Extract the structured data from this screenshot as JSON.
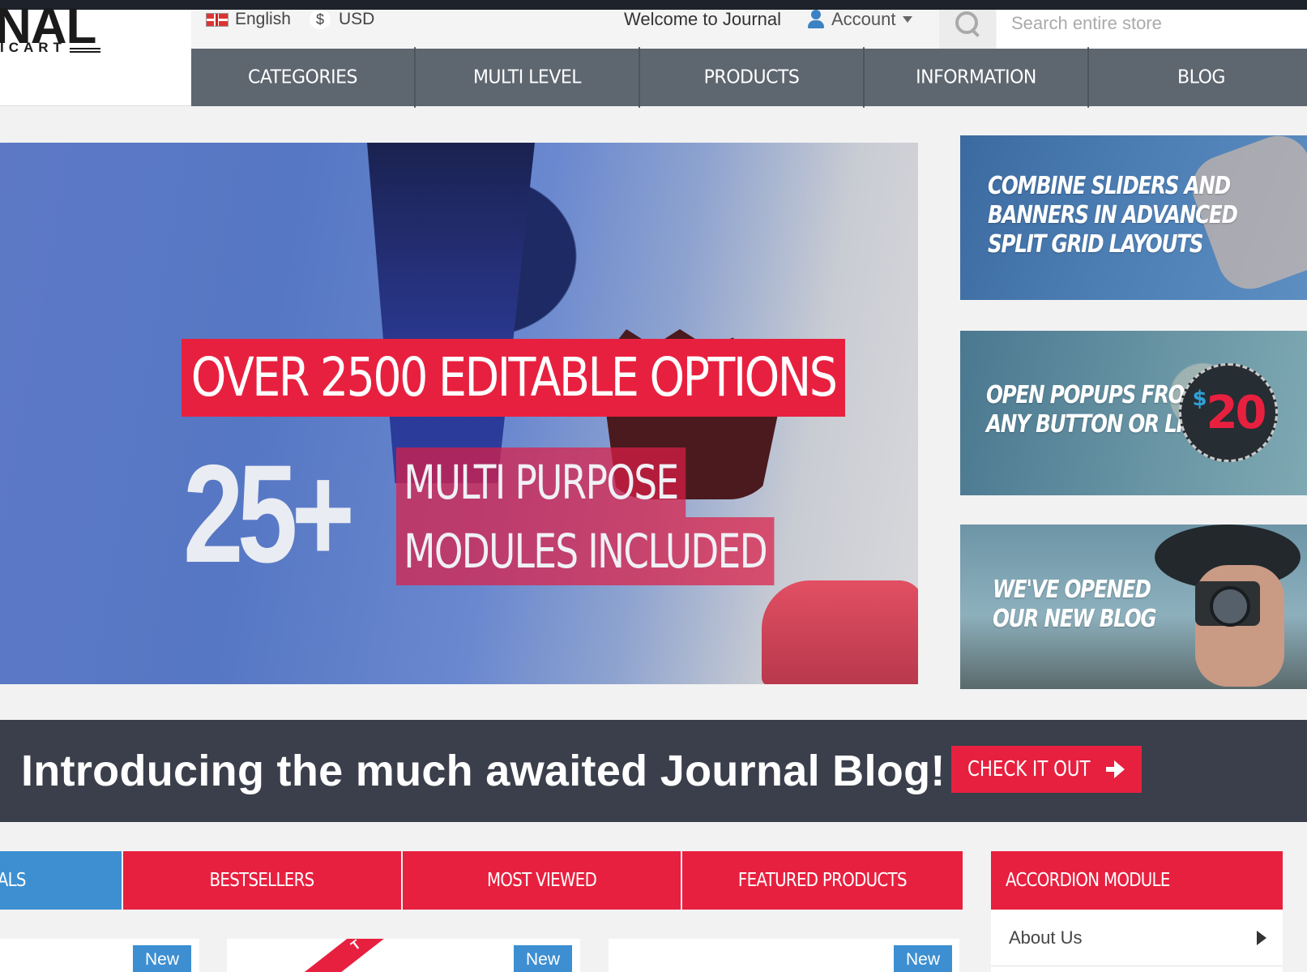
{
  "logo": {
    "word": "NAL",
    "subword": "ICART"
  },
  "topbar": {
    "language": "English",
    "currency_symbol": "$",
    "currency": "USD",
    "welcome": "Welcome to Journal",
    "account": "Account",
    "search_placeholder": "Search entire store"
  },
  "nav": [
    "CATEGORIES",
    "MULTI LEVEL",
    "PRODUCTS",
    "INFORMATION",
    "BLOG"
  ],
  "hero": {
    "line1": "OVER 2500 EDITABLE OPTIONS",
    "big_number": "25+",
    "line2": "MULTI PURPOSE",
    "line3": "MODULES INCLUDED"
  },
  "banners": [
    {
      "text": "COMBINE SLIDERS AND\nBANNERS IN ADVANCED\nSPLIT GRID LAYOUTS"
    },
    {
      "text": "OPEN POPUPS FROM\nANY BUTTON OR LINK",
      "badge_symbol": "$",
      "badge_value": "20"
    },
    {
      "text": "WE'VE OPENED\nOUR NEW BLOG"
    }
  ],
  "blog_strip": {
    "title": "Introducing the much awaited Journal Blog!",
    "button": "CHECK IT OUT"
  },
  "tabs": [
    "IVALS",
    "BESTSELLERS",
    "MOST VIEWED",
    "FEATURED PRODUCTS"
  ],
  "accordion": {
    "title": "ACCORDION MODULE",
    "items": [
      "About Us"
    ]
  },
  "cards": [
    {
      "badge": "New"
    },
    {
      "badge": "New",
      "ribbon": "T"
    },
    {
      "badge": "New"
    }
  ],
  "colors": {
    "accent_red": "#e8203f",
    "accent_blue": "#3d8fd1",
    "nav_gray": "#5e6670",
    "strip_dark": "#3a3f4b"
  }
}
